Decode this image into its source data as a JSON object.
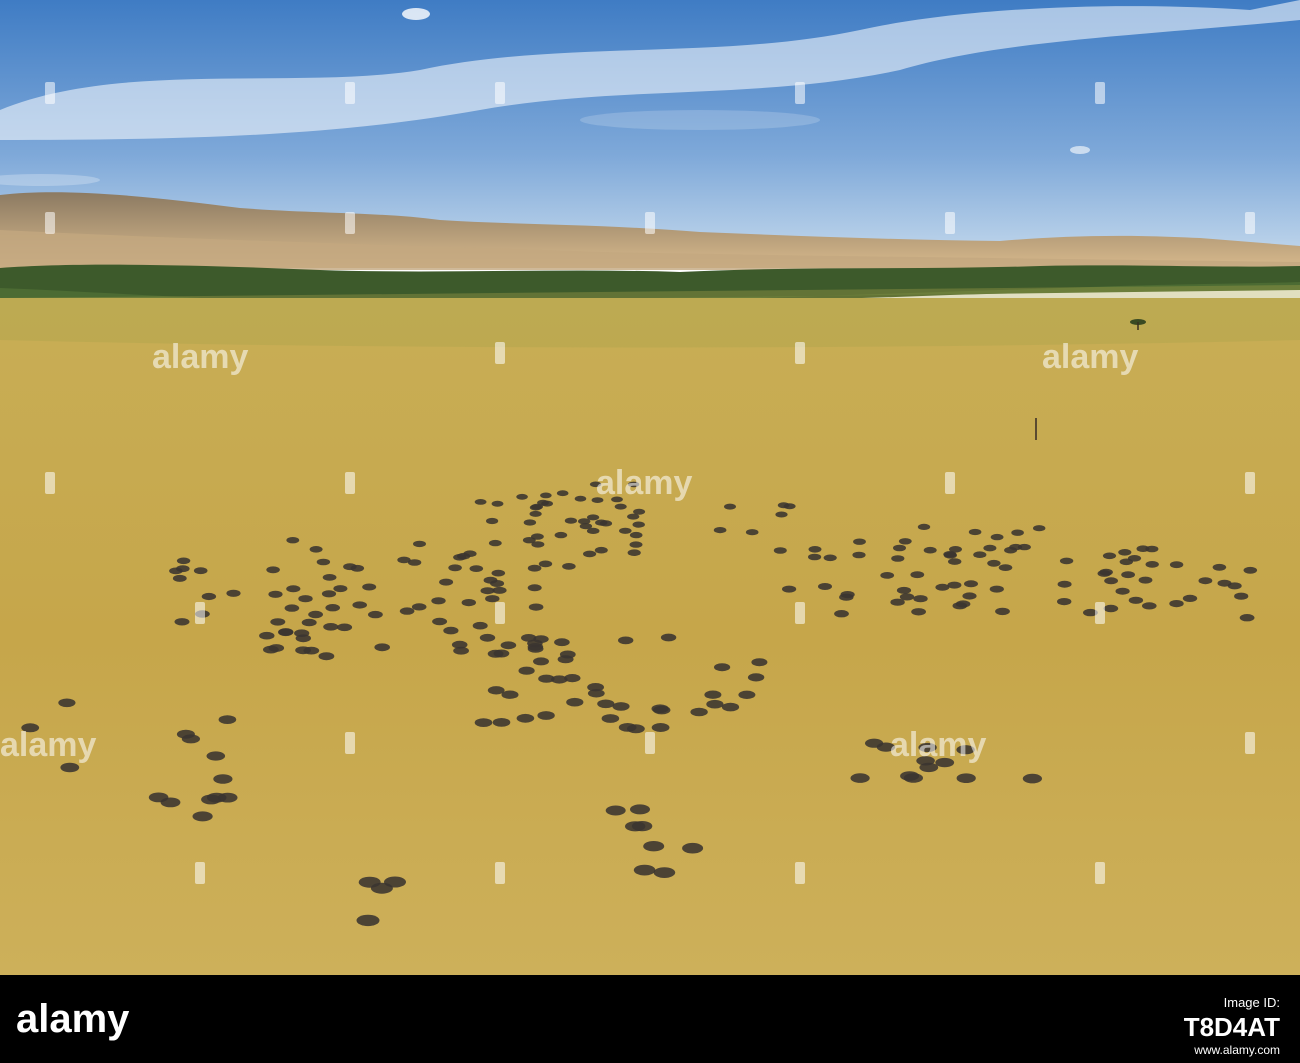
{
  "photo": {
    "subject": "aerial view of a herd of buffalo on savanna",
    "colors": {
      "sky_top": "#4f86c6",
      "sky_bottom": "#b9d2ea",
      "hills": "#b99a73",
      "trees": "#3e5a2a",
      "grass": "#c9ad4d",
      "animals": "#3a3430"
    }
  },
  "watermark": {
    "label": "alamy"
  },
  "footer": {
    "logo": "alamy",
    "image_id_label": "Image ID:",
    "image_id": "T8D4AT",
    "url": "www.alamy.com"
  }
}
